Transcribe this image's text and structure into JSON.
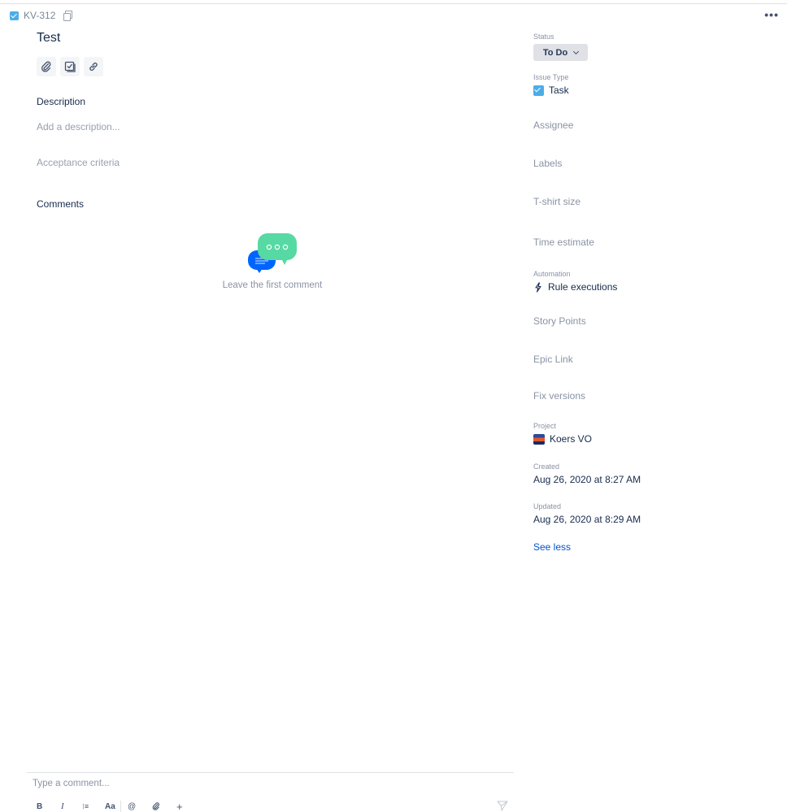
{
  "header": {
    "issue_key": "KV-312",
    "more_label": "•••"
  },
  "issue": {
    "title": "Test",
    "tools": [
      {
        "icon": "attachment-icon"
      },
      {
        "icon": "child-issue-icon"
      },
      {
        "icon": "link-icon"
      }
    ]
  },
  "description": {
    "heading": "Description",
    "placeholder": "Add a description...",
    "acceptance_placeholder": "Acceptance criteria"
  },
  "comments": {
    "heading": "Comments",
    "empty_message": "Leave the first comment",
    "input_placeholder": "Type a comment...",
    "toolbar": {
      "bold": "B",
      "italic": "I",
      "list": "⁝≡",
      "text_style": "Aa",
      "mention": "@",
      "attach": "📎",
      "more": "+"
    }
  },
  "fields": {
    "status_label": "Status",
    "status_value": "To Do",
    "issue_type_label": "Issue Type",
    "issue_type_value": "Task",
    "assignee": "Assignee",
    "labels": "Labels",
    "tshirt": "T-shirt size",
    "time_estimate": "Time estimate",
    "automation_label": "Automation",
    "automation_value": "Rule executions",
    "story_points": "Story Points",
    "epic_link": "Epic Link",
    "fix_versions": "Fix versions",
    "project_label": "Project",
    "project_value": "Koers VO",
    "created_label": "Created",
    "created_value": "Aug 26, 2020 at 8:27 AM",
    "updated_label": "Updated",
    "updated_value": "Aug 26, 2020 at 8:29 AM",
    "see_less": "See less"
  },
  "colors": {
    "accent": "#0052cc",
    "task_blue": "#4bade8",
    "chat_green": "#57d9a3",
    "chat_blue": "#0065ff"
  }
}
